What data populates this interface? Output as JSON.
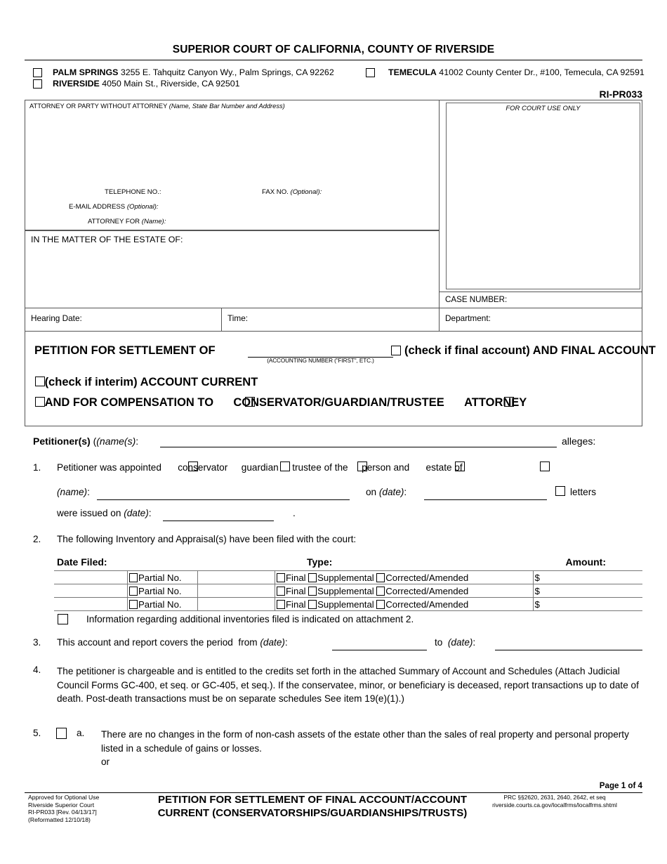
{
  "header": {
    "court_title": "SUPERIOR COURT OF CALIFORNIA, COUNTY OF RIVERSIDE",
    "locations": [
      {
        "name": "PALM SPRINGS",
        "address": "3255 E. Tahquitz Canyon Wy., Palm Springs, CA 92262"
      },
      {
        "name": "RIVERSIDE",
        "address": "4050 Main St., Riverside, CA 92501"
      },
      {
        "name": "TEMECULA",
        "address": "41002 County Center Dr., #100, Temecula, CA 92591"
      }
    ],
    "form_number": "RI-PR033"
  },
  "caption": {
    "attorney_label": "ATTORNEY OR PARTY WITHOUT ATTORNEY ",
    "attorney_label_italic": "(Name, State Bar Number and Address)",
    "telephone_label": "TELEPHONE NO.:",
    "fax_label": "FAX NO. ",
    "fax_label_italic": "(Optional):",
    "email_label": "E-MAIL ADDRESS ",
    "email_label_italic": "(Optional):",
    "attorney_for_label": "ATTORNEY FOR ",
    "attorney_for_italic": "(Name):",
    "court_use_label": "FOR COURT USE ONLY",
    "matter_label": "IN THE MATTER OF THE ESTATE OF:",
    "case_number_label": "CASE NUMBER:",
    "hearing_date_label": "Hearing Date:",
    "time_label": "Time:",
    "department_label": "Department:"
  },
  "title_box": {
    "line1": "PETITION FOR SETTLEMENT OF",
    "accounting_caption": "(ACCOUNTING NUMBER (\"FIRST\", ETC.)",
    "final_account": "(check if final account) AND FINAL ACCOUNT",
    "interim": "(check if interim) ACCOUNT CURRENT",
    "compensation": "AND FOR COMPENSATION TO",
    "cgt": "CONSERVATOR/GUARDIAN/TRUSTEE",
    "attorney": "ATTORNEY"
  },
  "petitioner": {
    "label_bold": "Petitioner(s) ",
    "label_italic": "(name(s)",
    "label_tail": ":",
    "alleges": "alleges:"
  },
  "items": {
    "n1": "1.",
    "n2": "2.",
    "n3": "3.",
    "n4": "4.",
    "n5": "5.",
    "item1_lead": "Petitioner was appointed",
    "item1_opt1": "conservator",
    "item1_opt2": "guardian",
    "item1_opt3": "trustee of the",
    "item1_opt4": "person and",
    "item1_opt5": "estate of",
    "item1_name_label": "(name):",
    "item1_on_date": "on (date):",
    "item1_letters": "letters",
    "item1_issued": "were issued on (date):",
    "item1_period": ".",
    "item2_text": "The following Inventory and Appraisal(s) have been filed with the court:",
    "item2_note": "Information regarding additional inventories filed is indicated on attachment 2.",
    "item3_text": "This account and report covers the period  from (date):",
    "item3_to": "to  (date):",
    "item4_text": "The petitioner is chargeable and is entitled to the credits set forth in the attached Summary of Account and Schedules (Attach Judicial Council Forms GC-400, et seq. or GC-405, et seq.).  If the conservatee, minor, or beneficiary is deceased, report transactions up to date of death. Post-death transactions must be on separate schedules See item 19(e)(1).)",
    "item5_a": "a.",
    "item5_text": "There are no changes in the form of non-cash assets of the estate other than the sales of real property and personal property listed in a schedule of gains or losses.",
    "item5_or": "or"
  },
  "inventory_table": {
    "headers": {
      "date_filed": "Date Filed:",
      "type": "Type:",
      "amount": "Amount:"
    },
    "rows": [
      {
        "partial": "Partial No.",
        "final": "Final",
        "supplemental": "Supplemental",
        "corrected": "Corrected/Amended",
        "amount": "$"
      },
      {
        "partial": "Partial No.",
        "final": "Final",
        "supplemental": "Supplemental",
        "corrected": "Corrected/Amended",
        "amount": "$"
      },
      {
        "partial": "Partial No.",
        "final": "Final",
        "supplemental": "Supplemental",
        "corrected": "Corrected/Amended",
        "amount": "$"
      }
    ]
  },
  "footer": {
    "page_of": "Page 1 of 4",
    "left_line1": "Approved for Optional Use",
    "left_line2": "Riverside Superior Court",
    "left_line3": "RI-PR033  [Rev. 04/13/17]",
    "left_line4": "(Reformatted 12/10/18)",
    "center_line1": "PETITION FOR SETTLEMENT OF FINAL ACCOUNT/ACCOUNT",
    "center_line2": "CURRENT (CONSERVATORSHIPS/GUARDIANSHIPS/TRUSTS)",
    "right_line1": "PRC §§2620, 2631, 2640, 2642, et seq",
    "right_line2": "riverside.courts.ca.gov/localfrms/localfrms.shtml"
  }
}
